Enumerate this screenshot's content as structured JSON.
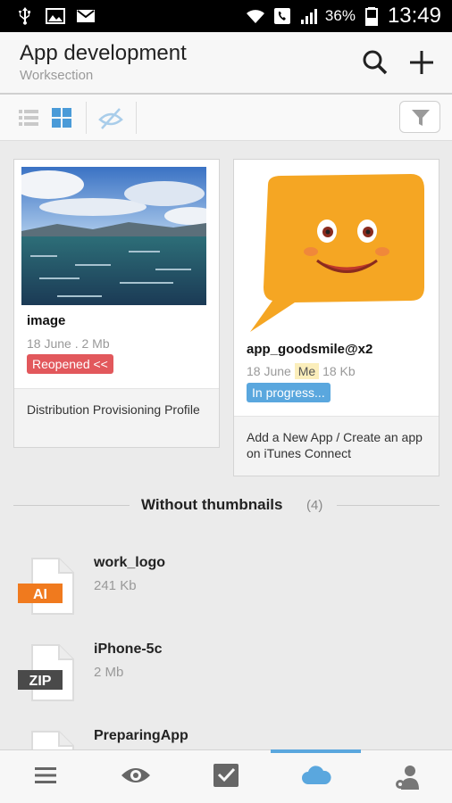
{
  "status_bar": {
    "left_icons": [
      "usb-icon",
      "image-icon",
      "gmail-icon"
    ],
    "right_icons": [
      "wifi-icon",
      "call-icon",
      "signal-icon",
      "battery-icon"
    ],
    "battery_percent": "36%",
    "time": "13:49"
  },
  "app_bar": {
    "title": "App development",
    "subtitle": "Worksection",
    "actions": [
      "search-icon",
      "add-icon"
    ]
  },
  "toolbar": {
    "view_modes": [
      "list-view-icon",
      "grid-view-icon"
    ],
    "active_view": "grid",
    "hide_icon": "eye-off-icon",
    "filter_icon": "filter-icon"
  },
  "cards": [
    {
      "name": "image",
      "meta": "18 June . 2 Mb",
      "status": "Reopened <<",
      "status_color": "#e2585c",
      "description": "Distribution Provisioning Profile"
    },
    {
      "name": "app_goodsmile@x2",
      "date": "18 June",
      "owner_tag": "Me",
      "size": "18 Kb",
      "status": "In progress...",
      "status_color": "#5aa7de",
      "description": "Add a New App / Create an app on iTunes Connect"
    }
  ],
  "section": {
    "title": "Without thumbnails",
    "count": "(4)"
  },
  "files": [
    {
      "name": "work_logo",
      "size": "241 Kb",
      "type": "AI",
      "type_color": "#f07a1e"
    },
    {
      "name": "iPhone-5c",
      "size": "2 Mb",
      "type": "ZIP",
      "type_color": "#4a4a4a"
    },
    {
      "name": "PreparingApp",
      "size": "",
      "type": "",
      "type_color": "#4a4a4a"
    }
  ],
  "bottom_nav": {
    "items": [
      "menu-icon",
      "eye-icon",
      "checkbox-icon",
      "cloud-icon",
      "user-settings-icon"
    ],
    "active": "cloud-icon",
    "accent": "#5aa7de"
  }
}
